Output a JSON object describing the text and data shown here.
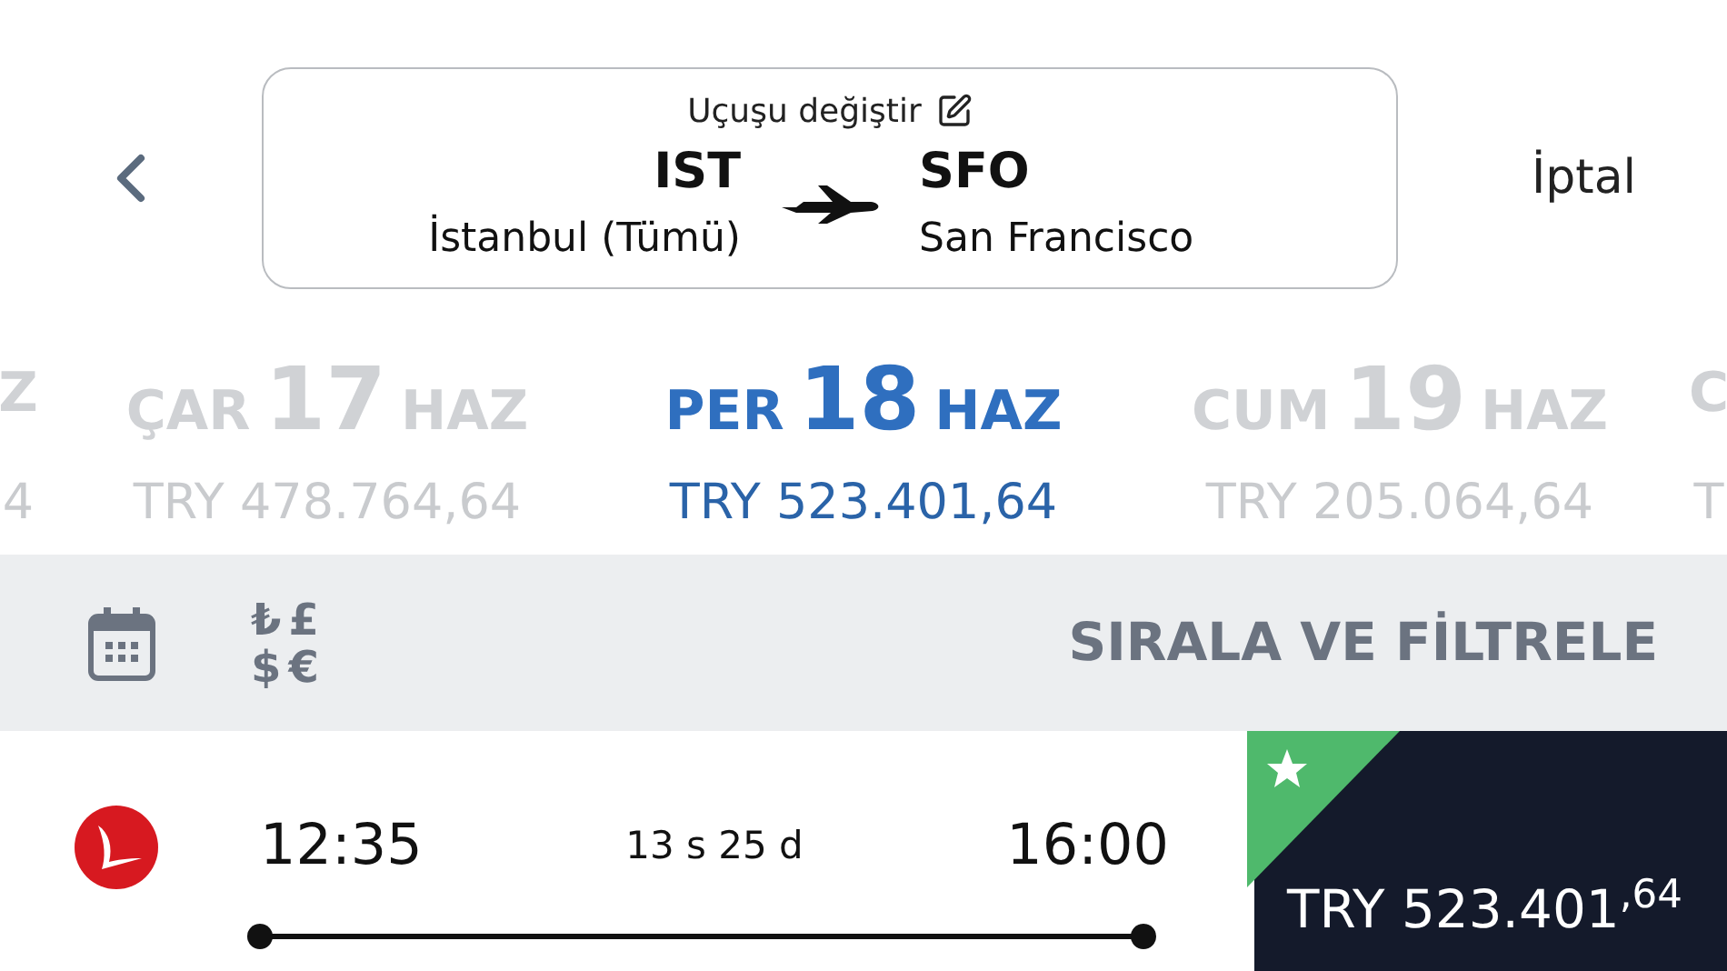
{
  "header": {
    "change_label": "Uçuşu değiştir",
    "origin": {
      "code": "IST",
      "city": "İstanbul (Tümü)"
    },
    "destination": {
      "code": "SFO",
      "city": "San Francisco"
    },
    "cancel": "İptal"
  },
  "dates": [
    {
      "kind": "edge",
      "day": "Z",
      "price": "4",
      "selected": false
    },
    {
      "kind": "full",
      "weekday": "ÇAR",
      "day": "17",
      "month": "HAZ",
      "price": "TRY 478.764,64",
      "selected": false
    },
    {
      "kind": "full",
      "weekday": "PER",
      "day": "18",
      "month": "HAZ",
      "price": "TRY 523.401,64",
      "selected": true
    },
    {
      "kind": "full",
      "weekday": "CUM",
      "day": "19",
      "month": "HAZ",
      "price": "TRY 205.064,64",
      "selected": false
    },
    {
      "kind": "edge",
      "day": "C",
      "price": "T",
      "selected": false
    }
  ],
  "toolbar": {
    "currency_symbols": [
      "₺",
      "£",
      "$",
      "€"
    ],
    "sort_filter": "SIRALA VE FİLTRELE"
  },
  "flights": [
    {
      "departure": "12:35",
      "duration": "13 s 25 d",
      "arrival": "16:00",
      "price": "TRY 523.401$^{,64}$",
      "featured": true
    }
  ]
}
